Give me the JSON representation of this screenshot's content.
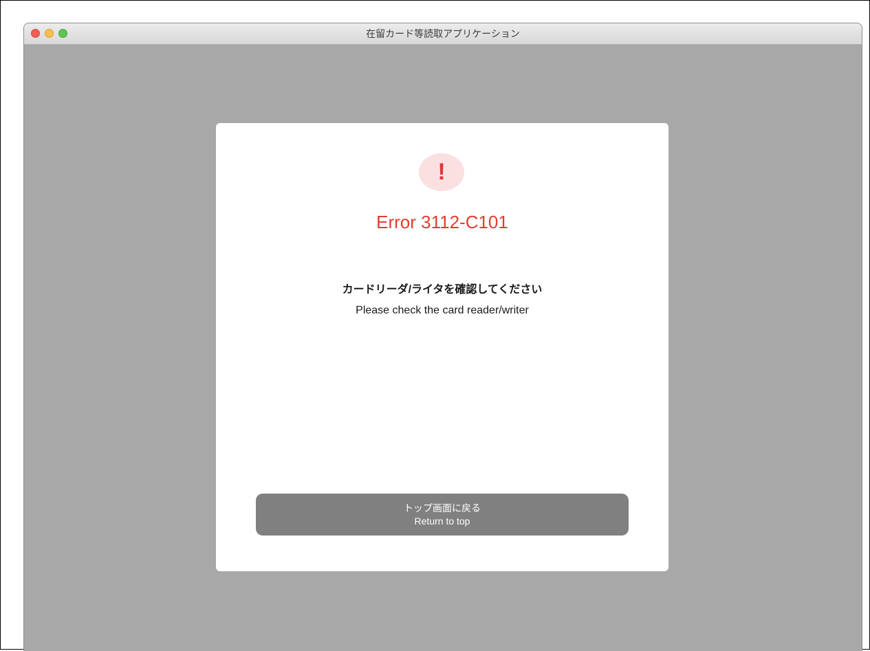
{
  "window": {
    "title": "在留カード等読取アプリケーション"
  },
  "dialog": {
    "icon": "exclamation-icon",
    "icon_glyph": "!",
    "error_code": "Error 3112-C101",
    "message_ja": "カードリーダ/ライタを確認してください",
    "message_en": "Please check the card reader/writer",
    "return_button": {
      "label_ja": "トップ画面に戻る",
      "label_en": "Return to top"
    }
  },
  "colors": {
    "error_red": "#e43c2f",
    "icon_background": "#fbe0e1",
    "button_gray": "#808080",
    "window_background": "#a8a8a8"
  }
}
